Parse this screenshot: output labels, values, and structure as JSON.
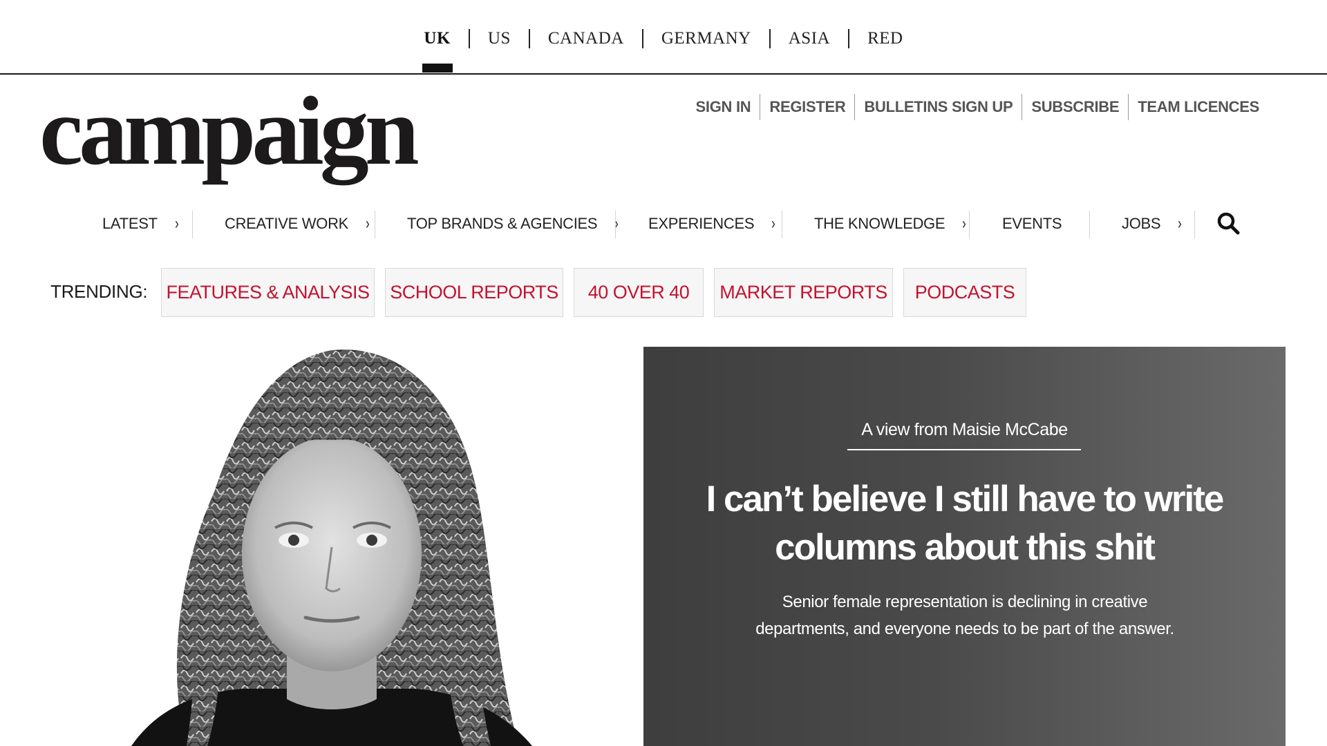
{
  "editions": [
    {
      "label": "UK",
      "active": true
    },
    {
      "label": "US",
      "active": false
    },
    {
      "label": "CANADA",
      "active": false
    },
    {
      "label": "GERMANY",
      "active": false
    },
    {
      "label": "ASIA",
      "active": false
    },
    {
      "label": "RED",
      "active": false
    }
  ],
  "logo": {
    "text": "campaign"
  },
  "account": {
    "links": [
      "SIGN IN",
      "REGISTER",
      "BULLETINS SIGN UP",
      "SUBSCRIBE",
      "TEAM LICENCES"
    ]
  },
  "nav": {
    "items": [
      {
        "label": "LATEST",
        "has_submenu": true
      },
      {
        "label": "CREATIVE WORK",
        "has_submenu": true
      },
      {
        "label": "TOP BRANDS & AGENCIES",
        "has_submenu": true
      },
      {
        "label": "EXPERIENCES",
        "has_submenu": true
      },
      {
        "label": "THE KNOWLEDGE",
        "has_submenu": true
      },
      {
        "label": "EVENTS",
        "has_submenu": false
      },
      {
        "label": "JOBS",
        "has_submenu": true
      }
    ],
    "chevron": "›",
    "search_icon": "search-icon"
  },
  "trending": {
    "label": "TRENDING:",
    "items": [
      "FEATURES & ANALYSIS",
      "SCHOOL REPORTS",
      "40 OVER 40",
      "MARKET REPORTS",
      "PODCASTS"
    ],
    "accent_color": "#c4122f"
  },
  "hero": {
    "kicker": "A view from Maisie McCabe",
    "headline": "I can’t believe I still have to write columns about this shit",
    "standfirst": "Senior female representation is declining in creative departments, and everyone needs to be part of the answer.",
    "image": "black-and-white portrait photo"
  }
}
